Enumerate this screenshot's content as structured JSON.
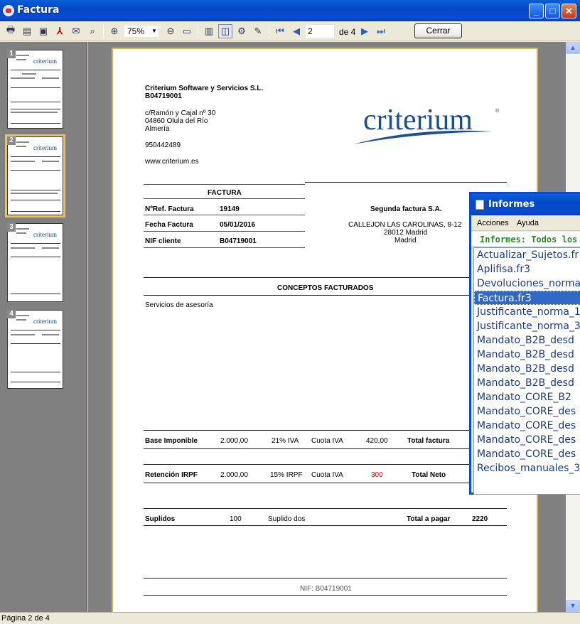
{
  "window": {
    "title": "Factura"
  },
  "toolbar": {
    "zoom": "75%",
    "page_current": "2",
    "page_of": "de 4",
    "close_label": "Cerrar"
  },
  "thumbnails": [
    {
      "num": "1",
      "logo": "criterium"
    },
    {
      "num": "2",
      "logo": "criterium"
    },
    {
      "num": "3",
      "logo": "criterium"
    },
    {
      "num": "4",
      "logo": "criterium"
    }
  ],
  "invoice": {
    "company": "Criterium Software y Servicios S.L.",
    "company_nif": "B04719001",
    "address1": "c/Ramón y Cajal nº 30",
    "address2": "04860 Olula del Río",
    "address3": "Almería",
    "phone": "950442489",
    "web": "www.criterium.es",
    "logo": "criterium",
    "logo_reg": "®",
    "factura_title": "FACTURA",
    "ref_label": "NºRef. Factura",
    "ref_value": "19149",
    "date_label": "Fecha Factura",
    "date_value": "05/01/2016",
    "nif_label": "NIF cliente",
    "nif_value": "B04719001",
    "client_name": "Segunda factura S.A.",
    "client_addr1": "CALLEJON LAS CAROLINAS, 8-12",
    "client_addr2": "28012 Madrid",
    "client_addr3": "Madrid",
    "conceptos_title": "CONCEPTOS FACTURADOS",
    "concepto1": "Servicios de asesoría",
    "base_label": "Base Imponible",
    "base_value": "2.000,00",
    "iva_pct": "21% IVA",
    "cuota_iva_label": "Cuota IVA",
    "cuota_iva_value": "420,00",
    "total_factura_label": "Total factura",
    "ret_label": "Retención IRPF",
    "ret_value": "2.000,00",
    "irpf_pct": "15% IRPF",
    "cuota_iva_label2": "Cuota IVA",
    "cuota_irpf_value": "300",
    "total_neto_label": "Total Neto",
    "suplidos_label": "Suplidos",
    "suplidos_value": "100",
    "suplido_desc": "Suplido dos",
    "total_pagar_label": "Total a pagar",
    "total_pagar_value": "2220",
    "footer_nif": "NIF: B04719001"
  },
  "status": {
    "text": "Página 2 de 4"
  },
  "informes": {
    "title": "Informes",
    "menu_acciones": "Acciones",
    "menu_ayuda": "Ayuda",
    "header": "Informes: Todos los archi",
    "items": [
      "Actualizar_Sujetos.fr",
      "Aplifisa.fr3",
      "Devoluciones_norma",
      "Factura.fr3",
      "Justificante_norma_1",
      "Justificante_norma_3",
      "Mandato_B2B_desd",
      "Mandato_B2B_desd",
      "Mandato_B2B_desd",
      "Mandato_B2B_desd",
      "Mandato_CORE_B2",
      "Mandato_CORE_des",
      "Mandato_CORE_des",
      "Mandato_CORE_des",
      "Mandato_CORE_des",
      "Recibos_manuales_3"
    ],
    "selected_index": 3
  },
  "colors": {
    "accent": "#316ac5",
    "logo": "#1a4f8c",
    "irpf_value": "#cc0000"
  }
}
